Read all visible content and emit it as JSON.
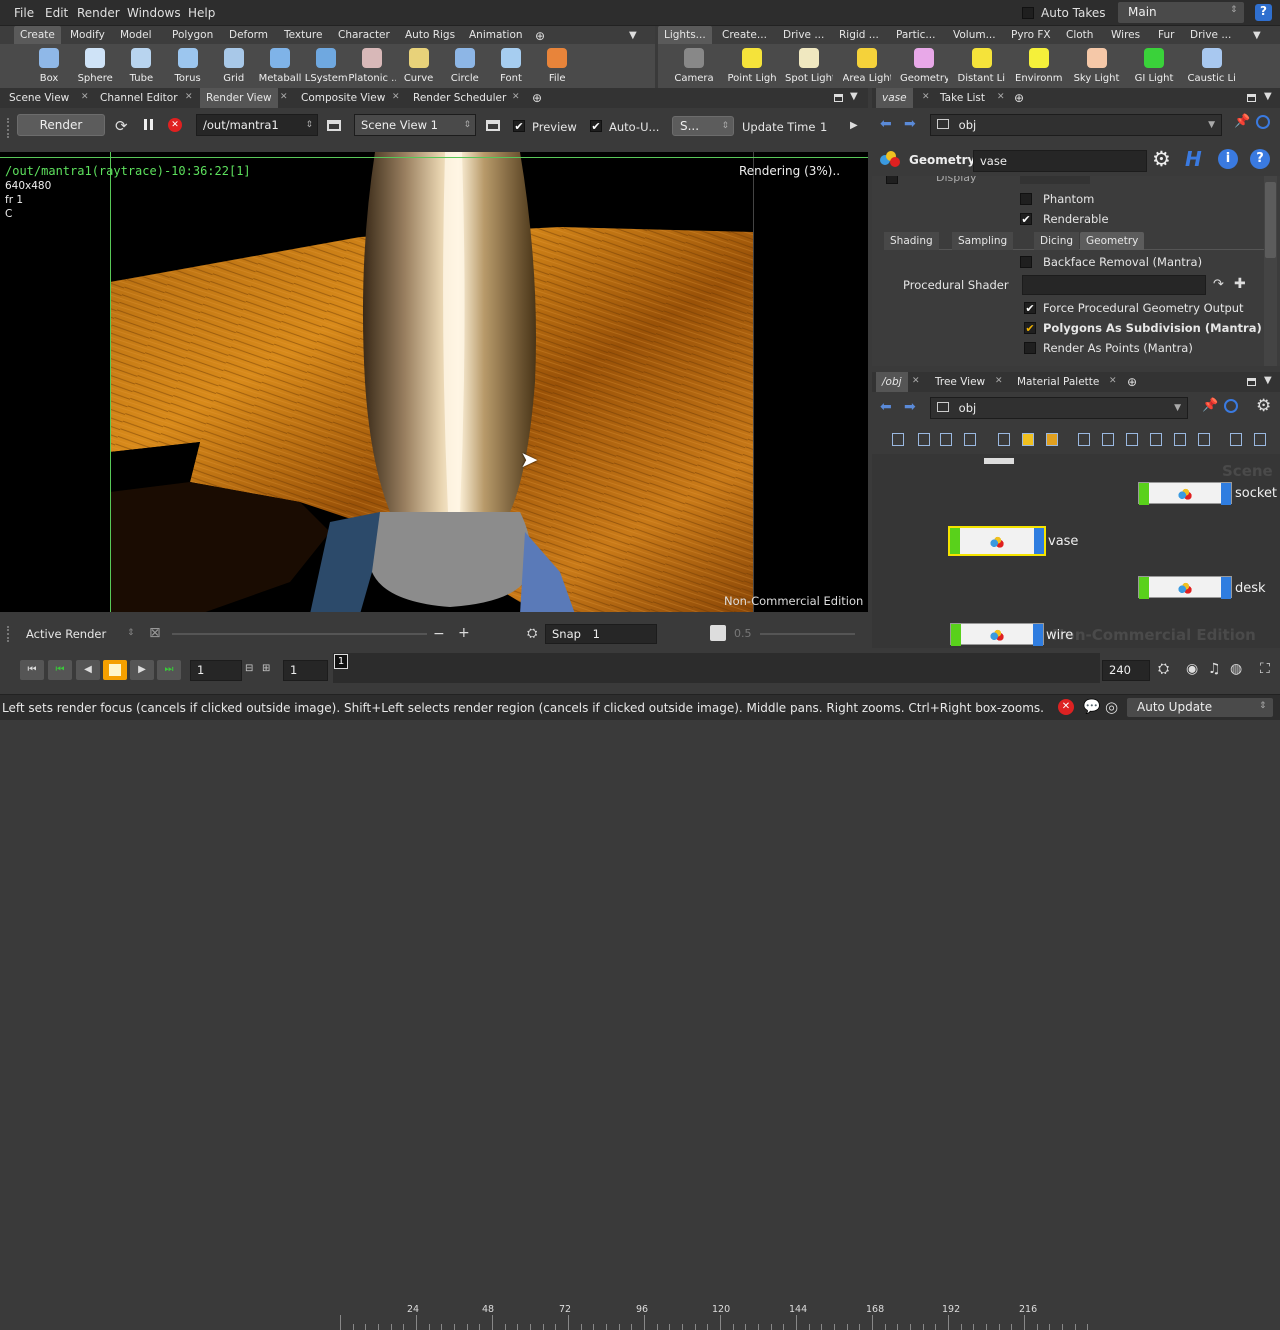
{
  "menubar": {
    "items": [
      "File",
      "Edit",
      "Render",
      "Windows",
      "Help"
    ],
    "auto_takes": "Auto Takes",
    "desktop": "Main"
  },
  "shelf_tabs_left": [
    "Create",
    "Modify",
    "Model",
    "Polygon",
    "Deform",
    "Texture",
    "Character",
    "Auto Rigs",
    "Animation"
  ],
  "shelf_tabs_right": [
    "Lights...",
    "Create...",
    "Drive ...",
    "Rigid ...",
    "Partic...",
    "Volum...",
    "Pyro FX",
    "Cloth",
    "Wires",
    "Fur",
    "Drive ..."
  ],
  "tools_left": [
    {
      "label": "Box",
      "icon": "box-icon",
      "color": "#8fb8e8"
    },
    {
      "label": "Sphere",
      "icon": "sphere-icon",
      "color": "#cfe3f7"
    },
    {
      "label": "Tube",
      "icon": "tube-icon",
      "color": "#b8d4ef"
    },
    {
      "label": "Torus",
      "icon": "torus-icon",
      "color": "#9cc6ef"
    },
    {
      "label": "Grid",
      "icon": "grid-icon",
      "color": "#a8c8e8"
    },
    {
      "label": "Metaball",
      "icon": "metaball-icon",
      "color": "#7fb3e8"
    },
    {
      "label": "LSystem",
      "icon": "lsystem-icon",
      "color": "#6fa8e0"
    },
    {
      "label": "Platonic ...",
      "icon": "platonic-icon",
      "color": "#d8b8b8"
    },
    {
      "label": "Curve",
      "icon": "curve-icon",
      "color": "#e8d27a"
    },
    {
      "label": "Circle",
      "icon": "circle-icon",
      "color": "#8db6e6"
    },
    {
      "label": "Font",
      "icon": "font-icon",
      "color": "#a6cdf0"
    },
    {
      "label": "File",
      "icon": "file-icon",
      "color": "#e8843a"
    }
  ],
  "tools_right": [
    {
      "label": "Camera",
      "icon": "camera-icon",
      "color": "#888888"
    },
    {
      "label": "Point Light",
      "icon": "point-light-icon",
      "color": "#f5e33a"
    },
    {
      "label": "Spot Light",
      "icon": "spot-light-icon",
      "color": "#f0e8c0"
    },
    {
      "label": "Area Light",
      "icon": "area-light-icon",
      "color": "#f5d23a"
    },
    {
      "label": "Geometry...",
      "icon": "geometry-light-icon",
      "color": "#e8a8e8"
    },
    {
      "label": "Distant Li...",
      "icon": "distant-light-icon",
      "color": "#f5e33a"
    },
    {
      "label": "Environm...",
      "icon": "environment-light-icon",
      "color": "#f5f03a"
    },
    {
      "label": "Sky Light",
      "icon": "sky-light-icon",
      "color": "#f5c8a8"
    },
    {
      "label": "GI Light",
      "icon": "gi-light-icon",
      "color": "#3ad23a"
    },
    {
      "label": "Caustic Li...",
      "icon": "caustic-light-icon",
      "color": "#a8c8f0"
    }
  ],
  "left_pane_tabs": [
    "Scene View",
    "Channel Editor",
    "Render View",
    "Composite View",
    "Render Scheduler"
  ],
  "render_toolbar": {
    "render_label": "Render",
    "output_path": "/out/mantra1",
    "camera": "Scene View 1",
    "preview_label": "Preview",
    "auto_update_label": "Auto-U...",
    "snapshot": "S...",
    "update_time_label": "Update Time",
    "update_time_value": "1"
  },
  "viewport": {
    "render_info": "/out/mantra1(raytrace)-10:36:22[1]",
    "resolution": "640x480",
    "frame": "fr 1",
    "channel": "C",
    "status": "Rendering (3%)..",
    "watermark": "Non-Commercial Edition"
  },
  "render_bottom": {
    "active_render": "Active Render",
    "snap_label": "Snap",
    "snap_value": "1",
    "zoom": "0.5"
  },
  "param_pane": {
    "tabs": [
      "vase",
      "Take List"
    ],
    "path": "obj",
    "node_type": "Geometry",
    "node_name": "vase",
    "display_label": "Display",
    "phantom": "Phantom",
    "renderable": "Renderable",
    "sub_tabs": [
      "Shading",
      "Sampling",
      "Dicing",
      "Geometry"
    ],
    "backface": "Backface Removal (Mantra)",
    "procedural_shader": "Procedural Shader",
    "force_procedural": "Force Procedural Geometry Output",
    "polygons_subdiv": "Polygons As Subdivision (Mantra)",
    "render_points": "Render As Points (Mantra)"
  },
  "network_pane": {
    "tabs": [
      "/obj",
      "Tree View",
      "Material Palette"
    ],
    "path": "obj",
    "watermark_top": "Scene",
    "watermark_bottom": "Non-Commercial Edition",
    "nodes": [
      "socket",
      "vase",
      "desk",
      "wire"
    ]
  },
  "timeline": {
    "frame": "1",
    "start": "1",
    "end": "240",
    "ticks": [
      "1",
      "24",
      "48",
      "72",
      "96",
      "120",
      "144",
      "168",
      "192",
      "216"
    ]
  },
  "statusbar": {
    "message": "Left sets render focus (cancels if clicked outside image). Shift+Left selects render region (cancels if clicked outside image). Middle pans. Right zooms. Ctrl+Right box-zooms.",
    "auto_update": "Auto Update"
  }
}
